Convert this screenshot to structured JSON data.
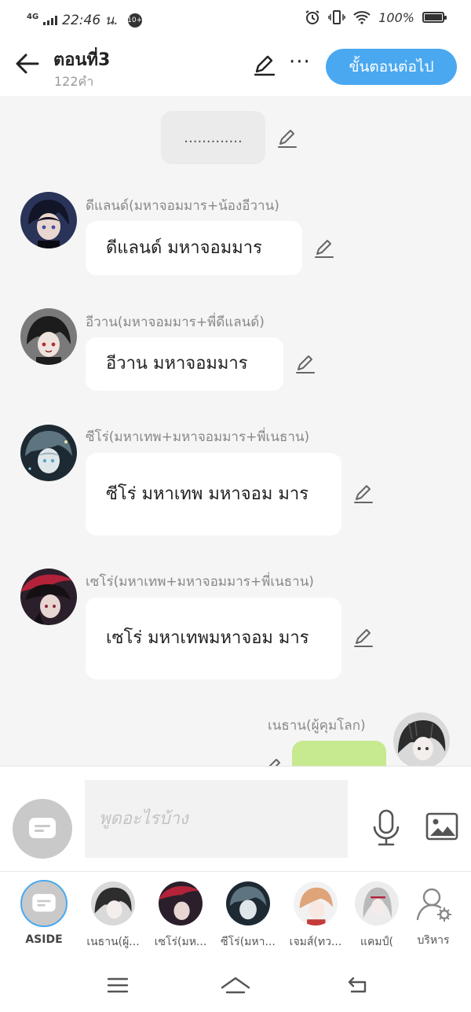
{
  "status_bar": {
    "network": "4G",
    "time": "22:46 น.",
    "badge": "10+",
    "battery": "100%"
  },
  "header": {
    "title": "ตอนที่3",
    "word_count": "122คำ",
    "next_label": "ขั้นตอนต่อไป",
    "more_label": "···"
  },
  "chat": {
    "narration": ".............",
    "messages": [
      {
        "name": "ดีแลนด์(มหาจอมมาร+น้องอีวาน)",
        "text": "ดีแลนด์ มหาจอมมาร",
        "side": "left"
      },
      {
        "name": "อีวาน(มหาจอมมาร+พี่ดีแลนด์)",
        "text": "อีวาน มหาจอมมาร",
        "side": "left"
      },
      {
        "name": "ซีโร่(มหาเทพ+มหาจอมมาร+พี่เนธาน)",
        "text": "ซีโร่ มหาเทพ มหาจอม มาร",
        "side": "left"
      },
      {
        "name": "เซโร่(มหาเทพ+มหาจอมมาร+พี่เนธาน)",
        "text": "เซโร่ มหาเทพมหาจอม มาร",
        "side": "left"
      },
      {
        "name": "เนธาน(ผู้คุมโลก)",
        "text": "",
        "side": "right"
      }
    ]
  },
  "composer": {
    "placeholder": "พูดอะไรบ้าง"
  },
  "characters": [
    {
      "label": "ASIDE"
    },
    {
      "label": "เนธาน(ผู้..."
    },
    {
      "label": "เซโร่(มห..."
    },
    {
      "label": "ซีโร่(มหา..."
    },
    {
      "label": "เจมส์(ทว..."
    },
    {
      "label": "แคมป์("
    },
    {
      "label": "บริหาร"
    }
  ],
  "colors": {
    "accent": "#4aa8f0",
    "chat_background": "#f5f5f5",
    "own_bubble": "#c7e98f"
  }
}
